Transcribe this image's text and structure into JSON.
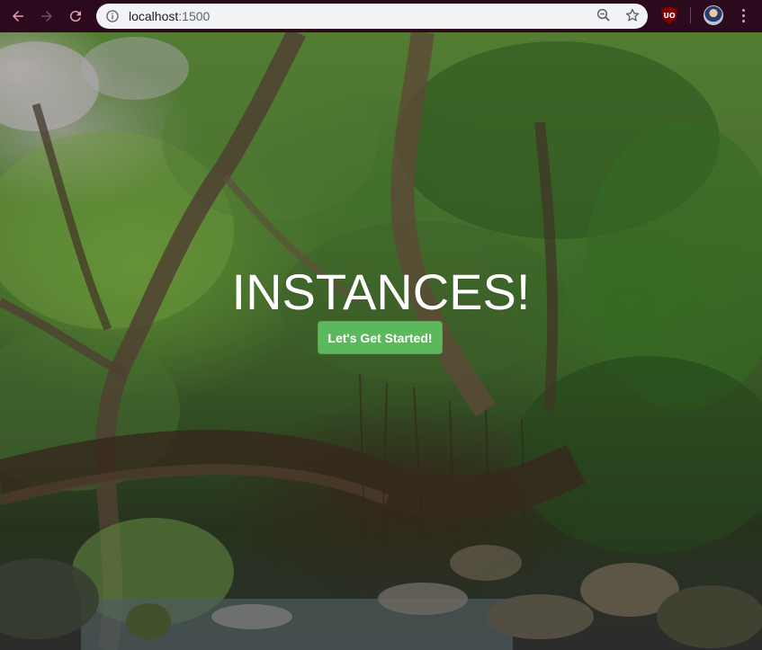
{
  "browser": {
    "url_host": "localhost",
    "url_port": ":1500",
    "back_icon": "arrow-left-icon",
    "forward_icon": "arrow-right-icon",
    "reload_icon": "reload-icon",
    "site_info_icon": "info-icon",
    "zoom_icon": "zoom-out-icon",
    "bookmark_icon": "star-icon",
    "extension_icon": "ublock-origin-icon",
    "extension_label": "UO",
    "menu_icon": "kebab-menu-icon",
    "chrome_color": "#2b0a1e"
  },
  "hero": {
    "title": "INSTANCES!",
    "cta_label": "Let's Get Started!",
    "cta_color": "#5cb85c",
    "background": "forest-living-root-bridge-photo"
  }
}
